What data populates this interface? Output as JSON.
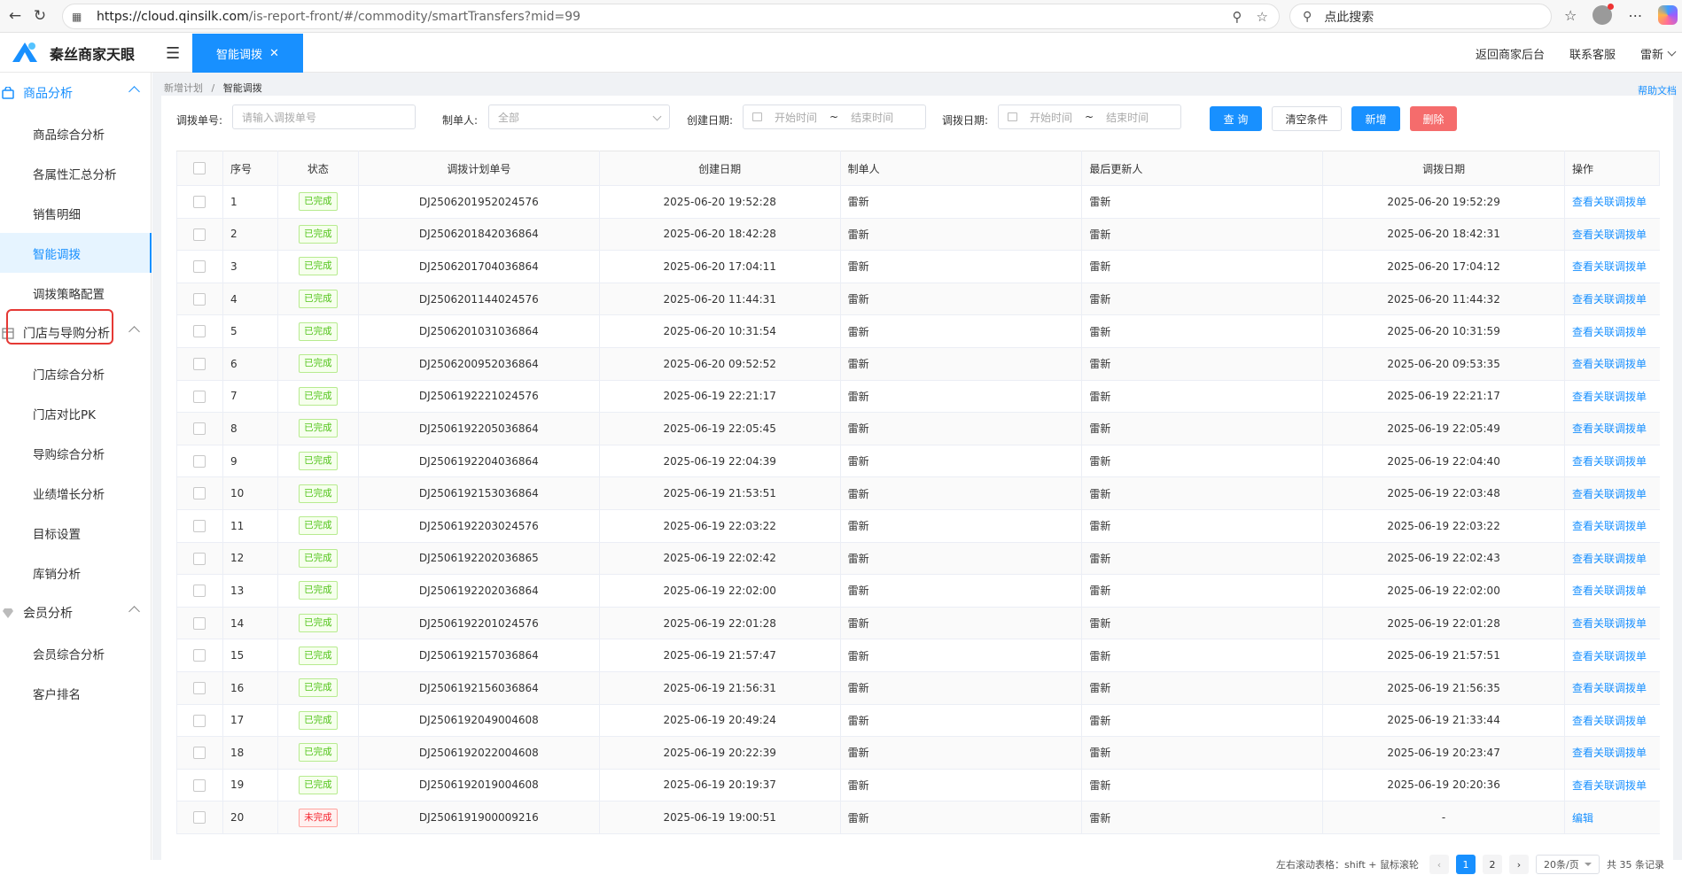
{
  "browser": {
    "url_main": "https://cloud.qinsilk.com",
    "url_rest": "/is-report-front/#/commodity/smartTransfers?mid=99",
    "search_placeholder": "点此搜索"
  },
  "header": {
    "brand": "秦丝商家天眼",
    "active_tab": "智能调拨",
    "back_label": "返回商家后台",
    "service_label": "联系客服",
    "user_name": "雷新"
  },
  "sidebar": {
    "groups": [
      {
        "label": "商品分析",
        "items": [
          "商品综合分析",
          "各属性汇总分析",
          "销售明细",
          "智能调拨",
          "调拨策略配置"
        ]
      },
      {
        "label": "门店与导购分析",
        "items": [
          "门店综合分析",
          "门店对比PK",
          "导购综合分析",
          "业绩增长分析",
          "目标设置",
          "库销分析"
        ]
      },
      {
        "label": "会员分析",
        "items": [
          "会员综合分析",
          "客户排名"
        ]
      }
    ]
  },
  "breadcrumb": {
    "parent": "新增计划",
    "sep": "/",
    "current": "智能调拨"
  },
  "help_label": "帮助文档",
  "filters": {
    "order_no_label": "调拨单号:",
    "order_no_placeholder": "请输入调拨单号",
    "maker_label": "制单人:",
    "maker_value": "全部",
    "create_date_label": "创建日期:",
    "transfer_date_label": "调拨日期:",
    "start_placeholder": "开始时间",
    "end_placeholder": "结束时间",
    "tilde": "~",
    "query_btn": "查 询",
    "clear_btn": "清空条件",
    "add_btn": "新增",
    "delete_btn": "删除"
  },
  "table": {
    "columns": [
      "序号",
      "状态",
      "调拨计划单号",
      "创建日期",
      "制单人",
      "最后更新人",
      "调拨日期",
      "操作"
    ],
    "rows": [
      [
        "1",
        "已完成",
        "DJ2506201952024576",
        "2025-06-20 19:52:28",
        "雷新",
        "雷新",
        "2025-06-20 19:52:29",
        "查看关联调拨单"
      ],
      [
        "2",
        "已完成",
        "DJ2506201842036864",
        "2025-06-20 18:42:28",
        "雷新",
        "雷新",
        "2025-06-20 18:42:31",
        "查看关联调拨单"
      ],
      [
        "3",
        "已完成",
        "DJ2506201704036864",
        "2025-06-20 17:04:11",
        "雷新",
        "雷新",
        "2025-06-20 17:04:12",
        "查看关联调拨单"
      ],
      [
        "4",
        "已完成",
        "DJ2506201144024576",
        "2025-06-20 11:44:31",
        "雷新",
        "雷新",
        "2025-06-20 11:44:32",
        "查看关联调拨单"
      ],
      [
        "5",
        "已完成",
        "DJ2506201031036864",
        "2025-06-20 10:31:54",
        "雷新",
        "雷新",
        "2025-06-20 10:31:59",
        "查看关联调拨单"
      ],
      [
        "6",
        "已完成",
        "DJ2506200952036864",
        "2025-06-20 09:52:52",
        "雷新",
        "雷新",
        "2025-06-20 09:53:35",
        "查看关联调拨单"
      ],
      [
        "7",
        "已完成",
        "DJ2506192221024576",
        "2025-06-19 22:21:17",
        "雷新",
        "雷新",
        "2025-06-19 22:21:17",
        "查看关联调拨单"
      ],
      [
        "8",
        "已完成",
        "DJ2506192205036864",
        "2025-06-19 22:05:45",
        "雷新",
        "雷新",
        "2025-06-19 22:05:49",
        "查看关联调拨单"
      ],
      [
        "9",
        "已完成",
        "DJ2506192204036864",
        "2025-06-19 22:04:39",
        "雷新",
        "雷新",
        "2025-06-19 22:04:40",
        "查看关联调拨单"
      ],
      [
        "10",
        "已完成",
        "DJ2506192153036864",
        "2025-06-19 21:53:51",
        "雷新",
        "雷新",
        "2025-06-19 22:03:48",
        "查看关联调拨单"
      ],
      [
        "11",
        "已完成",
        "DJ2506192203024576",
        "2025-06-19 22:03:22",
        "雷新",
        "雷新",
        "2025-06-19 22:03:22",
        "查看关联调拨单"
      ],
      [
        "12",
        "已完成",
        "DJ2506192202036865",
        "2025-06-19 22:02:42",
        "雷新",
        "雷新",
        "2025-06-19 22:02:43",
        "查看关联调拨单"
      ],
      [
        "13",
        "已完成",
        "DJ2506192202036864",
        "2025-06-19 22:02:00",
        "雷新",
        "雷新",
        "2025-06-19 22:02:00",
        "查看关联调拨单"
      ],
      [
        "14",
        "已完成",
        "DJ2506192201024576",
        "2025-06-19 22:01:28",
        "雷新",
        "雷新",
        "2025-06-19 22:01:28",
        "查看关联调拨单"
      ],
      [
        "15",
        "已完成",
        "DJ2506192157036864",
        "2025-06-19 21:57:47",
        "雷新",
        "雷新",
        "2025-06-19 21:57:51",
        "查看关联调拨单"
      ],
      [
        "16",
        "已完成",
        "DJ2506192156036864",
        "2025-06-19 21:56:31",
        "雷新",
        "雷新",
        "2025-06-19 21:56:35",
        "查看关联调拨单"
      ],
      [
        "17",
        "已完成",
        "DJ2506192049004608",
        "2025-06-19 20:49:24",
        "雷新",
        "雷新",
        "2025-06-19 21:33:44",
        "查看关联调拨单"
      ],
      [
        "18",
        "已完成",
        "DJ2506192022004608",
        "2025-06-19 20:22:39",
        "雷新",
        "雷新",
        "2025-06-19 20:23:47",
        "查看关联调拨单"
      ],
      [
        "19",
        "已完成",
        "DJ2506192019004608",
        "2025-06-19 20:19:37",
        "雷新",
        "雷新",
        "2025-06-19 20:20:36",
        "查看关联调拨单"
      ],
      [
        "20",
        "未完成",
        "DJ2506191900009216",
        "2025-06-19 19:00:51",
        "雷新",
        "雷新",
        "-",
        "编辑"
      ]
    ]
  },
  "pagination": {
    "hint": "左右滚动表格：shift + 鼠标滚轮",
    "pages": [
      "1",
      "2"
    ],
    "current": "1",
    "page_size": "20条/页",
    "total": "共 35 条记录"
  },
  "colors": {
    "primary": "#1890ff",
    "danger": "#f56c6c",
    "done": "#52c41a",
    "undone": "#f5222d",
    "highlight_box": "#e53935"
  }
}
